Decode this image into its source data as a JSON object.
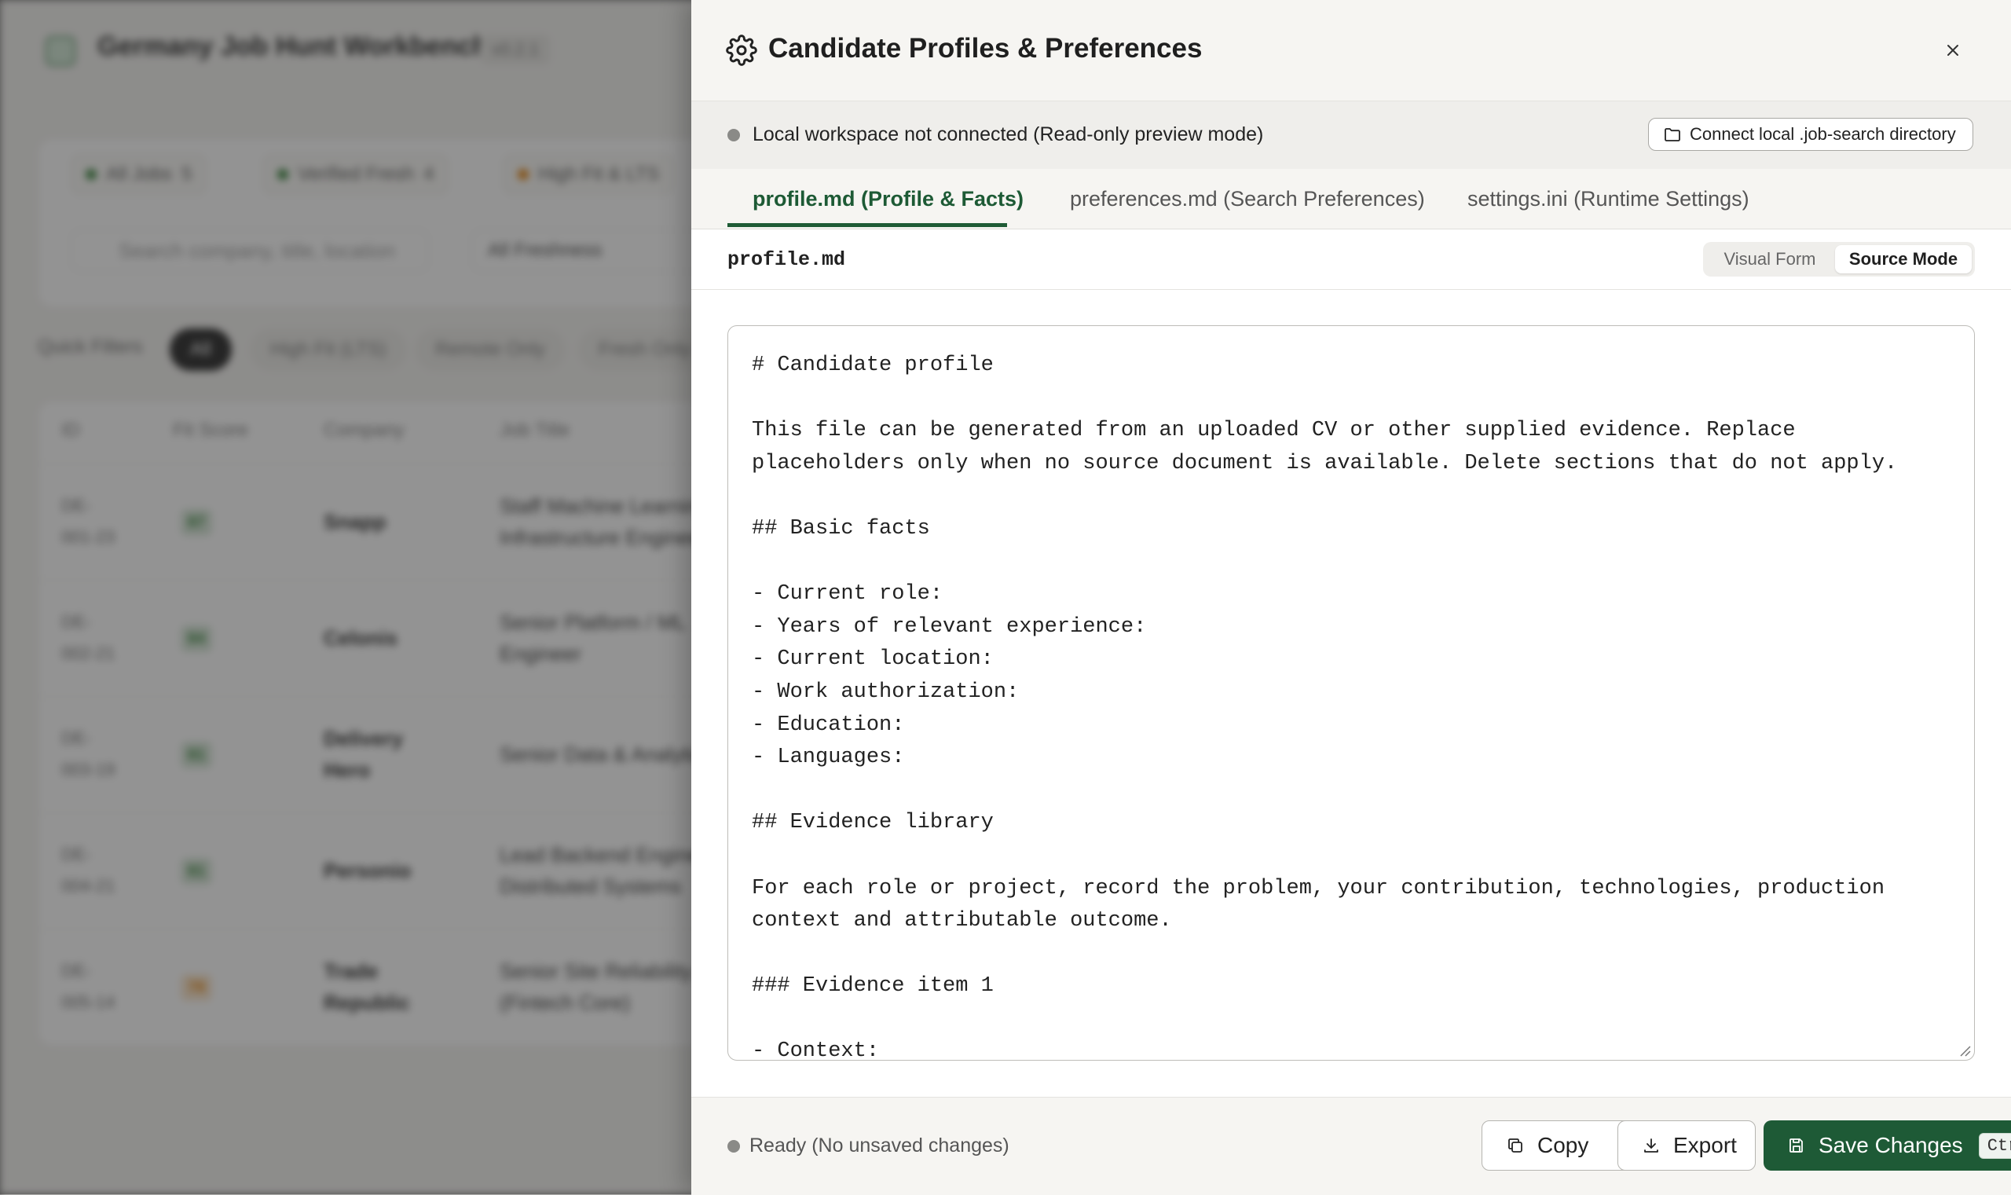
{
  "background_app": {
    "title": "Germany Job Hunt Workbench",
    "version": "v0.2.1",
    "pills": [
      {
        "label": "All Jobs",
        "count": "5",
        "color": "#2e7d32"
      },
      {
        "label": "Verified Fresh",
        "count": "4",
        "color": "#2e7d32"
      },
      {
        "label": "High Fit & LTS",
        "count": "",
        "color": "#e07b00"
      }
    ],
    "search_placeholder": "Search company, title, location",
    "freshness": "All Freshness",
    "quick_filters_label": "Quick Filters",
    "quick_filters": [
      "All",
      "High Fit (LTS)",
      "Remote Only",
      "Fresh Only"
    ],
    "columns": [
      "ID",
      "Fit Score",
      "Company",
      "Job Title"
    ],
    "rows": [
      {
        "id1": "DE-",
        "id2": "001-23",
        "score": "87",
        "score_color": "#2e7d32",
        "company": "Snapp",
        "company2": "",
        "title1": "Staff Machine Learning",
        "title2": "Infrastructure Engineer"
      },
      {
        "id1": "DE-",
        "id2": "002-21",
        "score": "84",
        "score_color": "#2e7d32",
        "company": "Celonis",
        "company2": "",
        "title1": "Senior Platform / ML",
        "title2": "Engineer"
      },
      {
        "id1": "DE-",
        "id2": "003-19",
        "score": "81",
        "score_color": "#2e7d32",
        "company": "Delivery",
        "company2": "Hero",
        "title1": "Senior Data & Analytics",
        "title2": ""
      },
      {
        "id1": "DE-",
        "id2": "004-21",
        "score": "81",
        "score_color": "#2e7d32",
        "company": "Personio",
        "company2": "",
        "title1": "Lead Backend Engineer",
        "title2": "Distributed Systems"
      },
      {
        "id1": "DE-",
        "id2": "005-14",
        "score": "78",
        "score_color": "#e07b00",
        "company": "Trade",
        "company2": "Republic",
        "title1": "Senior Site Reliability",
        "title2": "(Fintech Core)"
      }
    ]
  },
  "panel": {
    "title": "Candidate Profiles & Preferences",
    "notice": "Local workspace not connected (Read-only preview mode)",
    "connect_label": "Connect local .job-search directory",
    "tabs": [
      {
        "label": "profile.md (Profile & Facts)"
      },
      {
        "label": "preferences.md (Search Preferences)"
      },
      {
        "label": "settings.ini (Runtime Settings)"
      }
    ],
    "active_tab": 0,
    "file_name": "profile.md",
    "modes": {
      "visual": "Visual Form",
      "source": "Source Mode"
    },
    "active_mode": "source",
    "editor_content": "# Candidate profile\n\nThis file can be generated from an uploaded CV or other supplied evidence. Replace placeholders only when no source document is available. Delete sections that do not apply.\n\n## Basic facts\n\n- Current role:\n- Years of relevant experience:\n- Current location:\n- Work authorization:\n- Education:\n- Languages:\n\n## Evidence library\n\nFor each role or project, record the problem, your contribution, technologies, production context and attributable outcome.\n\n### Evidence item 1\n\n- Context:\n- Problem:\n- Contribution:",
    "status": "Ready (No unsaved changes)",
    "copy_label": "Copy",
    "export_label": "Export",
    "save_label": "Save Changes",
    "save_shortcut": "Ctrl+S",
    "accent_color": "#1e5a36"
  }
}
